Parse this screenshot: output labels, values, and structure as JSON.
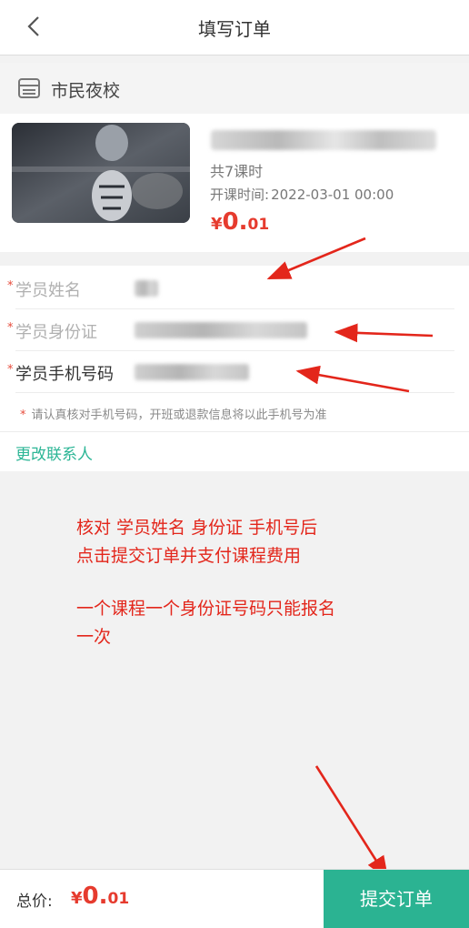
{
  "header": {
    "title": "填写订单",
    "back_icon": "chevron-left-icon"
  },
  "shop": {
    "icon": "store-icon",
    "name": "市民夜校"
  },
  "course": {
    "lessons": "共7课时",
    "start_label": "开课时间:",
    "start_time": "2022-03-01 00:00",
    "price_symbol": "¥",
    "price_int": "0.",
    "price_dec": "01"
  },
  "form": {
    "fields": [
      {
        "label": "学员姓名",
        "label_color": "#b0b0b0"
      },
      {
        "label": "学员身份证",
        "label_color": "#b0b0b0"
      },
      {
        "label": "学员手机号码",
        "label_color": "#333333"
      }
    ],
    "notice": "请认真核对手机号码，开班或退款信息将以此手机号为准",
    "required_mark": "*",
    "change_contact": "更改联系人"
  },
  "annotation": {
    "lines": [
      "核对 学员姓名  身份证 手机号后",
      "点击提交订单并支付课程费用",
      "",
      "一个课程一个身份证号码只能报名",
      "一次"
    ],
    "color": "#e3261b"
  },
  "footer": {
    "total_label": "总价:",
    "price_symbol": "¥",
    "price_int": "0.",
    "price_dec": "01",
    "submit_label": "提交订单"
  },
  "colors": {
    "accent": "#2bb392",
    "price": "#e63b2e"
  }
}
